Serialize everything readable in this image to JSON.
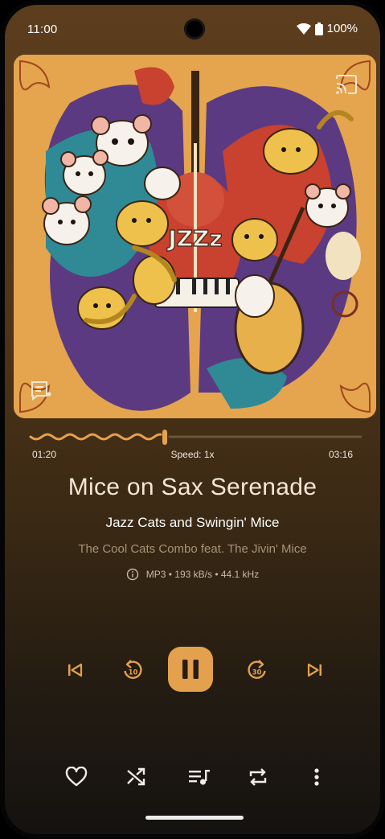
{
  "status_bar": {
    "time": "11:00",
    "battery": "100%",
    "icons": [
      "wifi-icon",
      "battery-icon"
    ]
  },
  "album_art": {
    "logo_text": "JZZz",
    "icons": [
      "cast-icon",
      "lyrics-icon"
    ]
  },
  "player": {
    "elapsed": "01:20",
    "speed": "Speed: 1x",
    "duration": "03:16",
    "progress": 0.408,
    "title": "Mice on Sax Serenade",
    "album": "Jazz Cats and Swingin' Mice",
    "artist": "The Cool Cats Combo feat. The Jivin' Mice",
    "format": "MP3 • 193 kB/s • 44.1 kHz",
    "state": "playing"
  },
  "controls": {
    "buttons": [
      "skip-previous-icon",
      "replay-10-icon",
      "pause-icon",
      "forward-30-icon",
      "skip-next-icon"
    ]
  },
  "actions": {
    "buttons": [
      "heart-icon",
      "shuffle-icon",
      "queue-music-icon",
      "repeat-icon",
      "more-vert-icon"
    ]
  },
  "colors": {
    "accent": "#e3a14e",
    "background_top": "#5c3d1d",
    "background_bottom": "#141210"
  }
}
